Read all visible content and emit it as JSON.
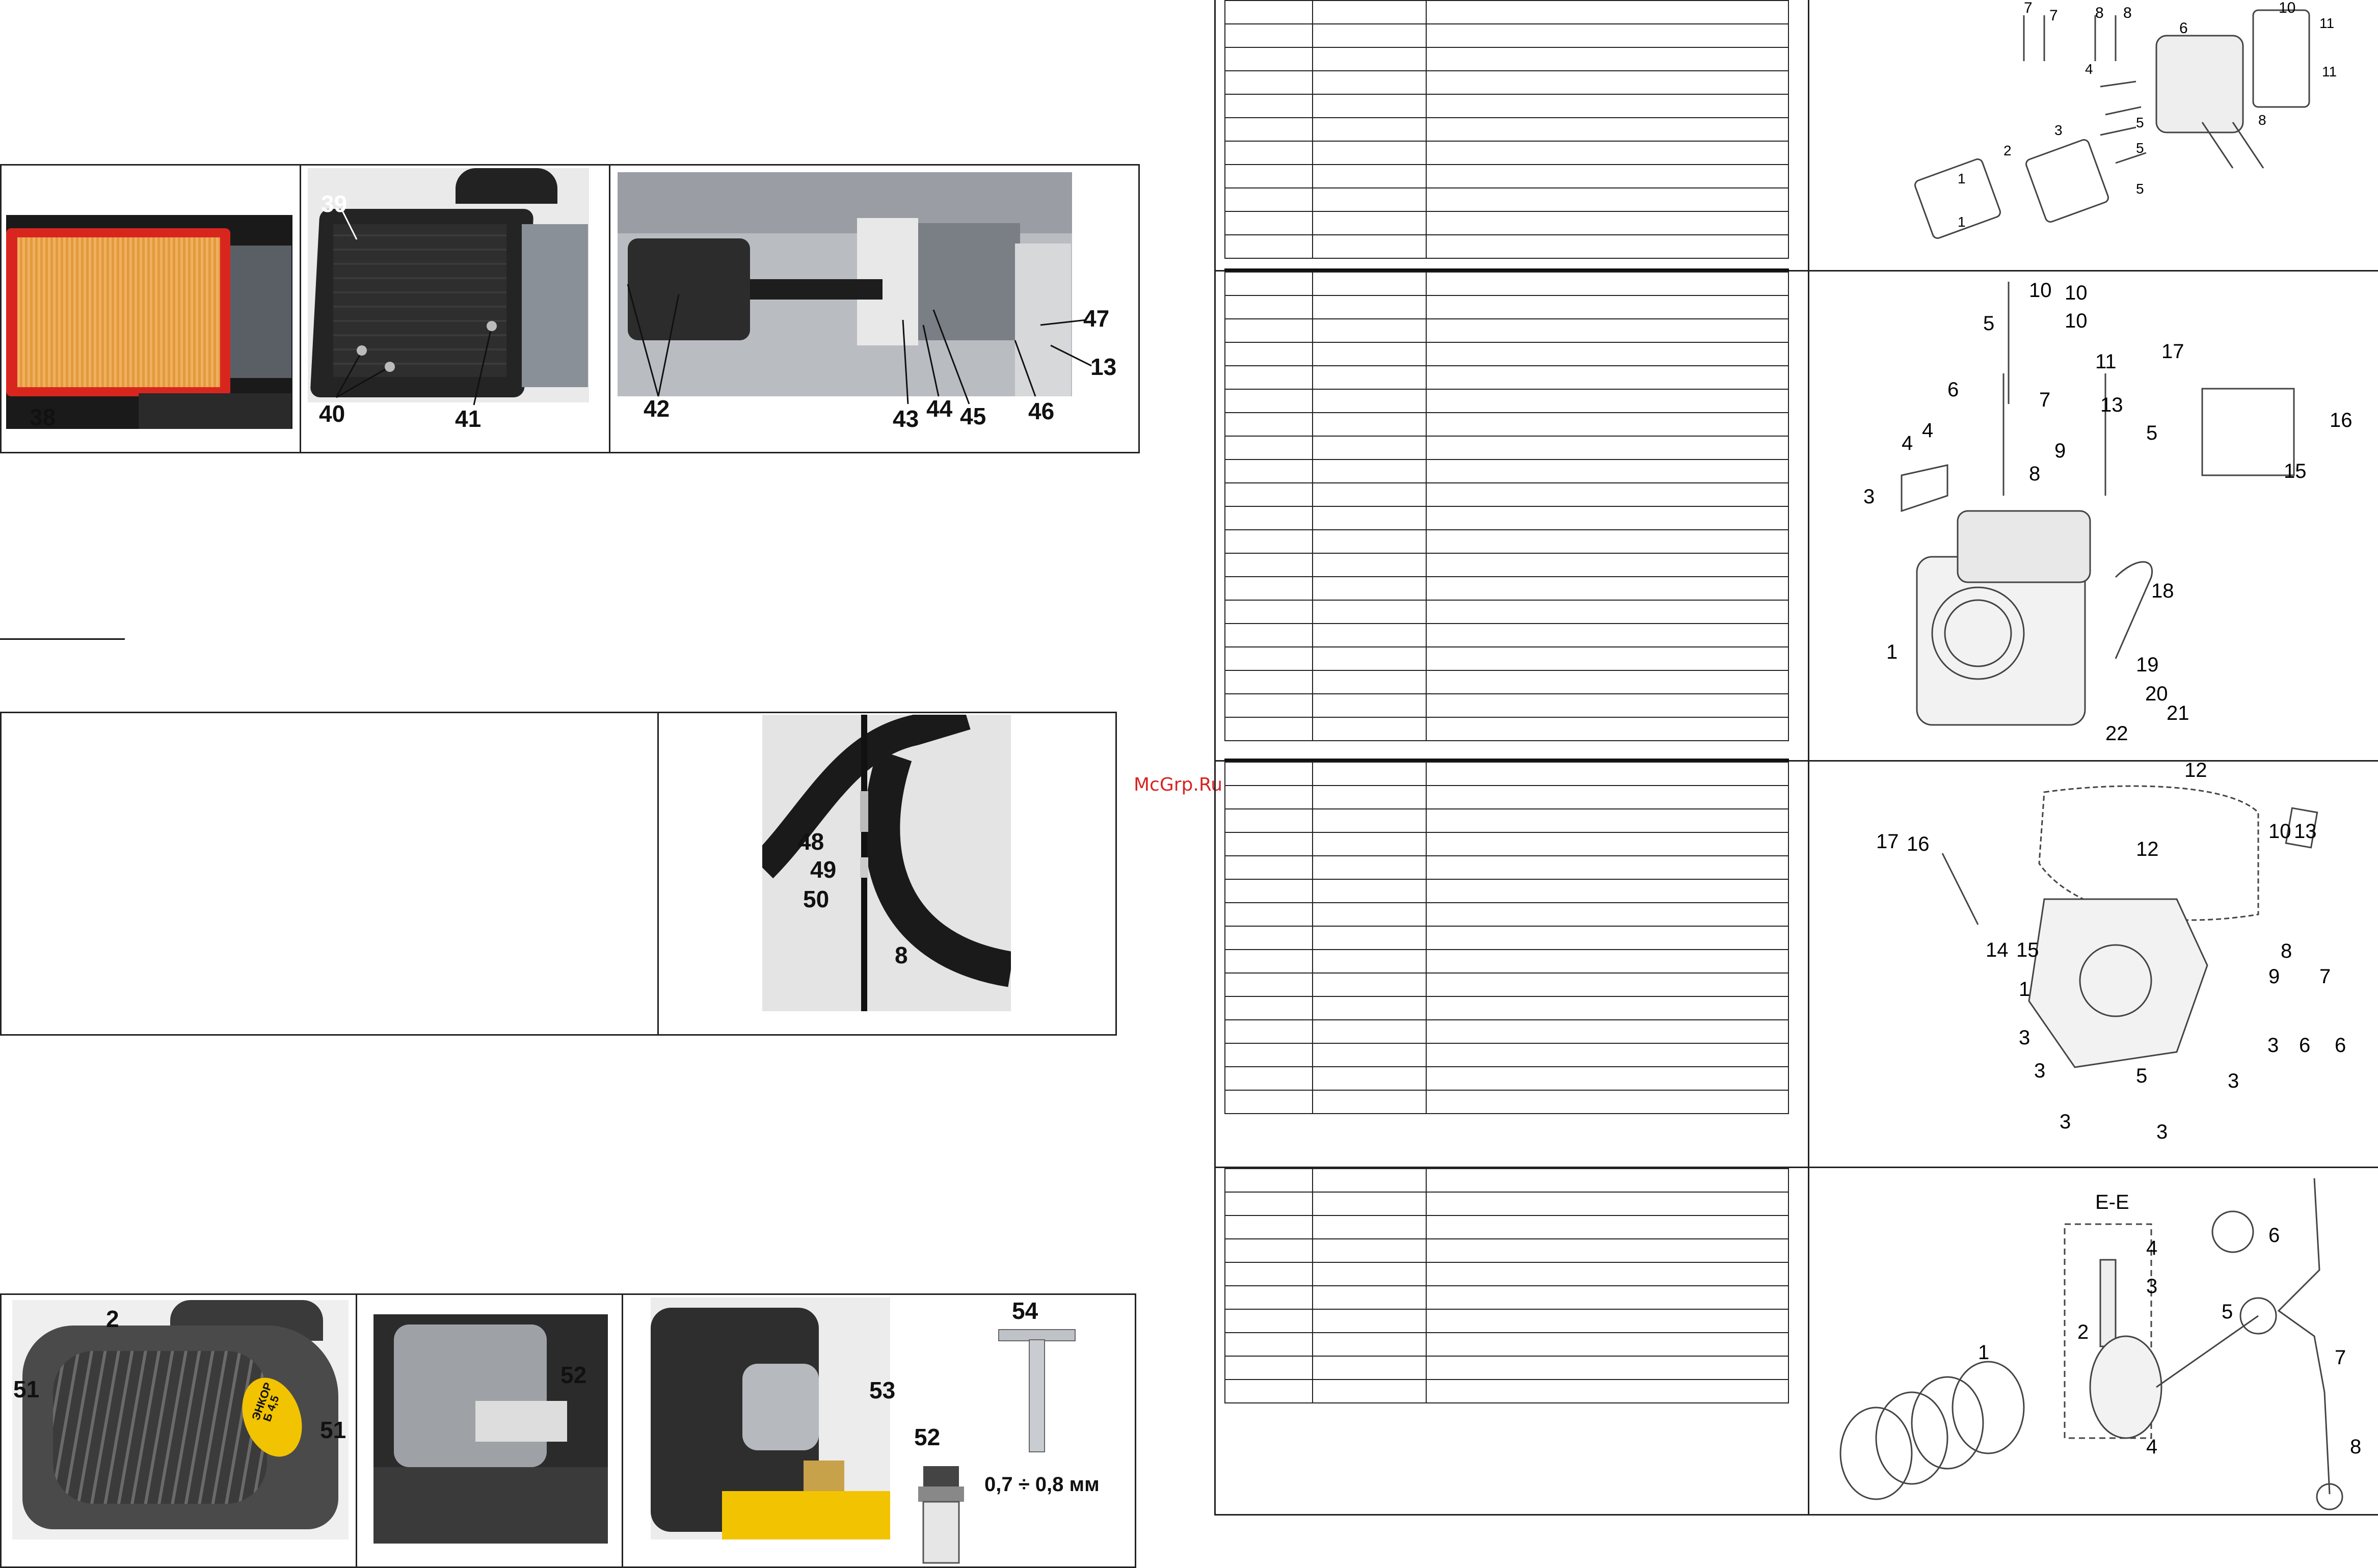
{
  "watermark": "McGrp.Ru",
  "figure_top": {
    "left_panel": {
      "callouts": [
        "38"
      ]
    },
    "mid_panel": {
      "callouts": [
        "39",
        "40",
        "41"
      ]
    },
    "right_panel": {
      "callouts": [
        "42",
        "43",
        "44",
        "45",
        "46",
        "47",
        "13"
      ]
    }
  },
  "figure_middle": {
    "callouts": [
      "48",
      "49",
      "50",
      "8"
    ]
  },
  "figure_bottom": {
    "panel1": {
      "callouts": [
        "2",
        "51",
        "51"
      ],
      "badge_line1": "ЭНКОР",
      "badge_line2": "Б 4,5"
    },
    "panel2": {
      "callouts": [
        "52"
      ]
    },
    "panel3": {
      "callouts": [
        "53",
        "52",
        "54"
      ],
      "gap_text": "0,7 ÷ 0,8 мм"
    }
  },
  "diagrams": {
    "cyl_head": {
      "labels": [
        "7",
        "7",
        "8",
        "8",
        "6",
        "10",
        "11",
        "11",
        "4",
        "5",
        "5",
        "5",
        "3",
        "1",
        "2",
        "1",
        "8"
      ]
    },
    "cyl_block": {
      "labels": [
        "10",
        "10",
        "10",
        "5",
        "11",
        "17",
        "13",
        "6",
        "7",
        "4",
        "4",
        "9",
        "5",
        "16",
        "15",
        "8",
        "3",
        "18",
        "1",
        "19",
        "20",
        "21",
        "22"
      ]
    },
    "crankcase": {
      "labels": [
        "12",
        "10",
        "13",
        "17",
        "16",
        "12",
        "14",
        "15",
        "8",
        "1",
        "9",
        "7",
        "3",
        "3",
        "6",
        "6",
        "3",
        "5",
        "3",
        "3",
        "3"
      ]
    },
    "crank": {
      "labels": [
        "Е-Е",
        "4",
        "3",
        "6",
        "2",
        "5",
        "1",
        "7",
        "4",
        "8"
      ]
    }
  },
  "tables": {
    "cyl_head_rows": 11,
    "cyl_block_rows": 20,
    "crankcase_rows": 15,
    "crank_rows": 10
  }
}
